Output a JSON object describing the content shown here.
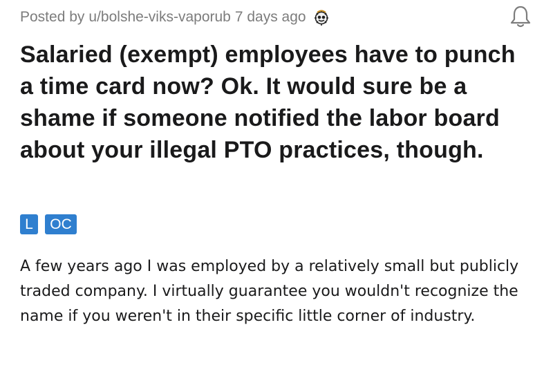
{
  "post": {
    "posted_by_prefix": "Posted by",
    "author": "u/bolshe-viks-vaporub",
    "age": "7 days ago",
    "award_icon": "award-gear-icon",
    "notify_icon": "bell-icon",
    "title": "Salaried (exempt) employees have to punch a time card now? Ok. It would sure be a shame if someone notified the labor board about your illegal PTO practices, though.",
    "flairs": [
      "L",
      "OC"
    ],
    "body": "A few years ago I was employed by a relatively small but publicly traded company. I virtually guarantee you wouldn't recognize the name if you weren't in their specific little corner of industry."
  },
  "colors": {
    "flair_bg": "#2f7fcf",
    "meta_text": "#7c7c7c",
    "text": "#1a1a1b"
  }
}
